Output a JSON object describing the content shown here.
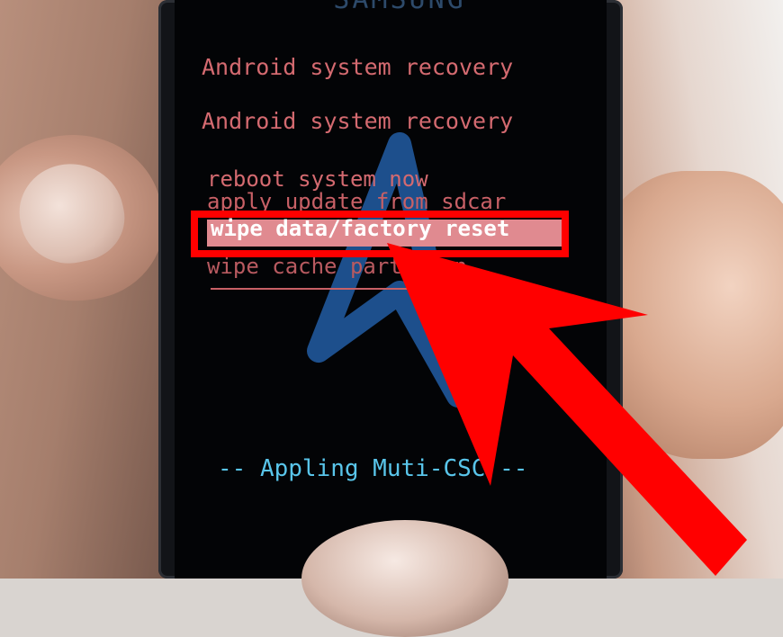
{
  "screen": {
    "brand_text": "SAMSUNG",
    "title_line_1": "Android system recovery",
    "title_line_2": "Android system recovery",
    "menu": {
      "items": [
        "reboot system now",
        "apply update from sdcar",
        "wipe data/factory reset",
        "wipe cache partition"
      ],
      "selected_index": 2
    },
    "status_text": "-- Appling Muti-CSC --"
  },
  "annotation": {
    "highlight_color": "#ff0000",
    "arrow_color": "#ff0000",
    "arrow_target": "wipe data/factory reset"
  },
  "colors": {
    "menu_text": "#d46a70",
    "selection_bar": "#e08a90",
    "status_text": "#59c5ea",
    "screen_background": "#030406"
  }
}
